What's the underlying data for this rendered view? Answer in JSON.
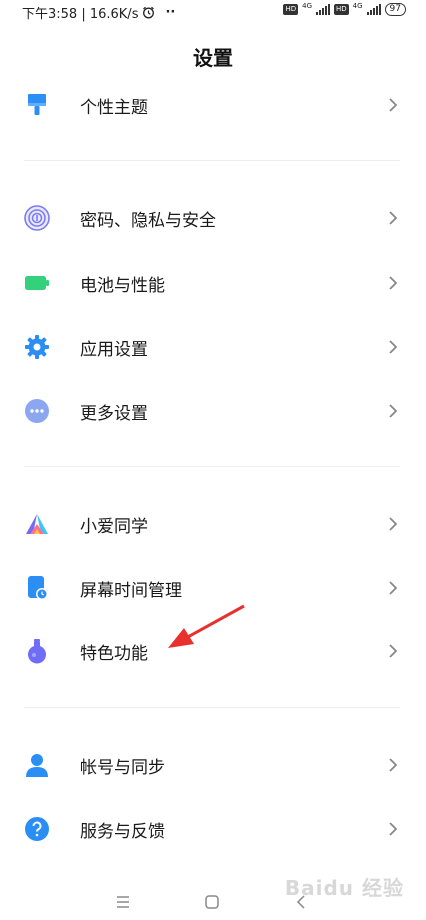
{
  "status_bar": {
    "time_speed": "下午3:58 | 16.6K/s",
    "more": "··",
    "sim1_type": "4G",
    "sim2_type": "4G",
    "hd": "HD",
    "battery": "97"
  },
  "header": {
    "title": "设置"
  },
  "menu": {
    "theme": "个性主题",
    "security": "密码、隐私与安全",
    "battery": "电池与性能",
    "apps": "应用设置",
    "more": "更多设置",
    "xiaoai": "小爱同学",
    "screentime": "屏幕时间管理",
    "features": "特色功能",
    "account": "帐号与同步",
    "feedback": "服务与反馈"
  },
  "watermark": "Baidu 经验",
  "colors": {
    "theme_icon": "#2b8ff5",
    "security_icon": "#7d7cf0",
    "battery_icon": "#33d17a",
    "apps_icon": "#2a8ef5",
    "more_icon": "#8aa7f0",
    "account_icon": "#2a8ef5",
    "feedback_icon": "#2a8ef5",
    "arrow": "#e8312f"
  }
}
